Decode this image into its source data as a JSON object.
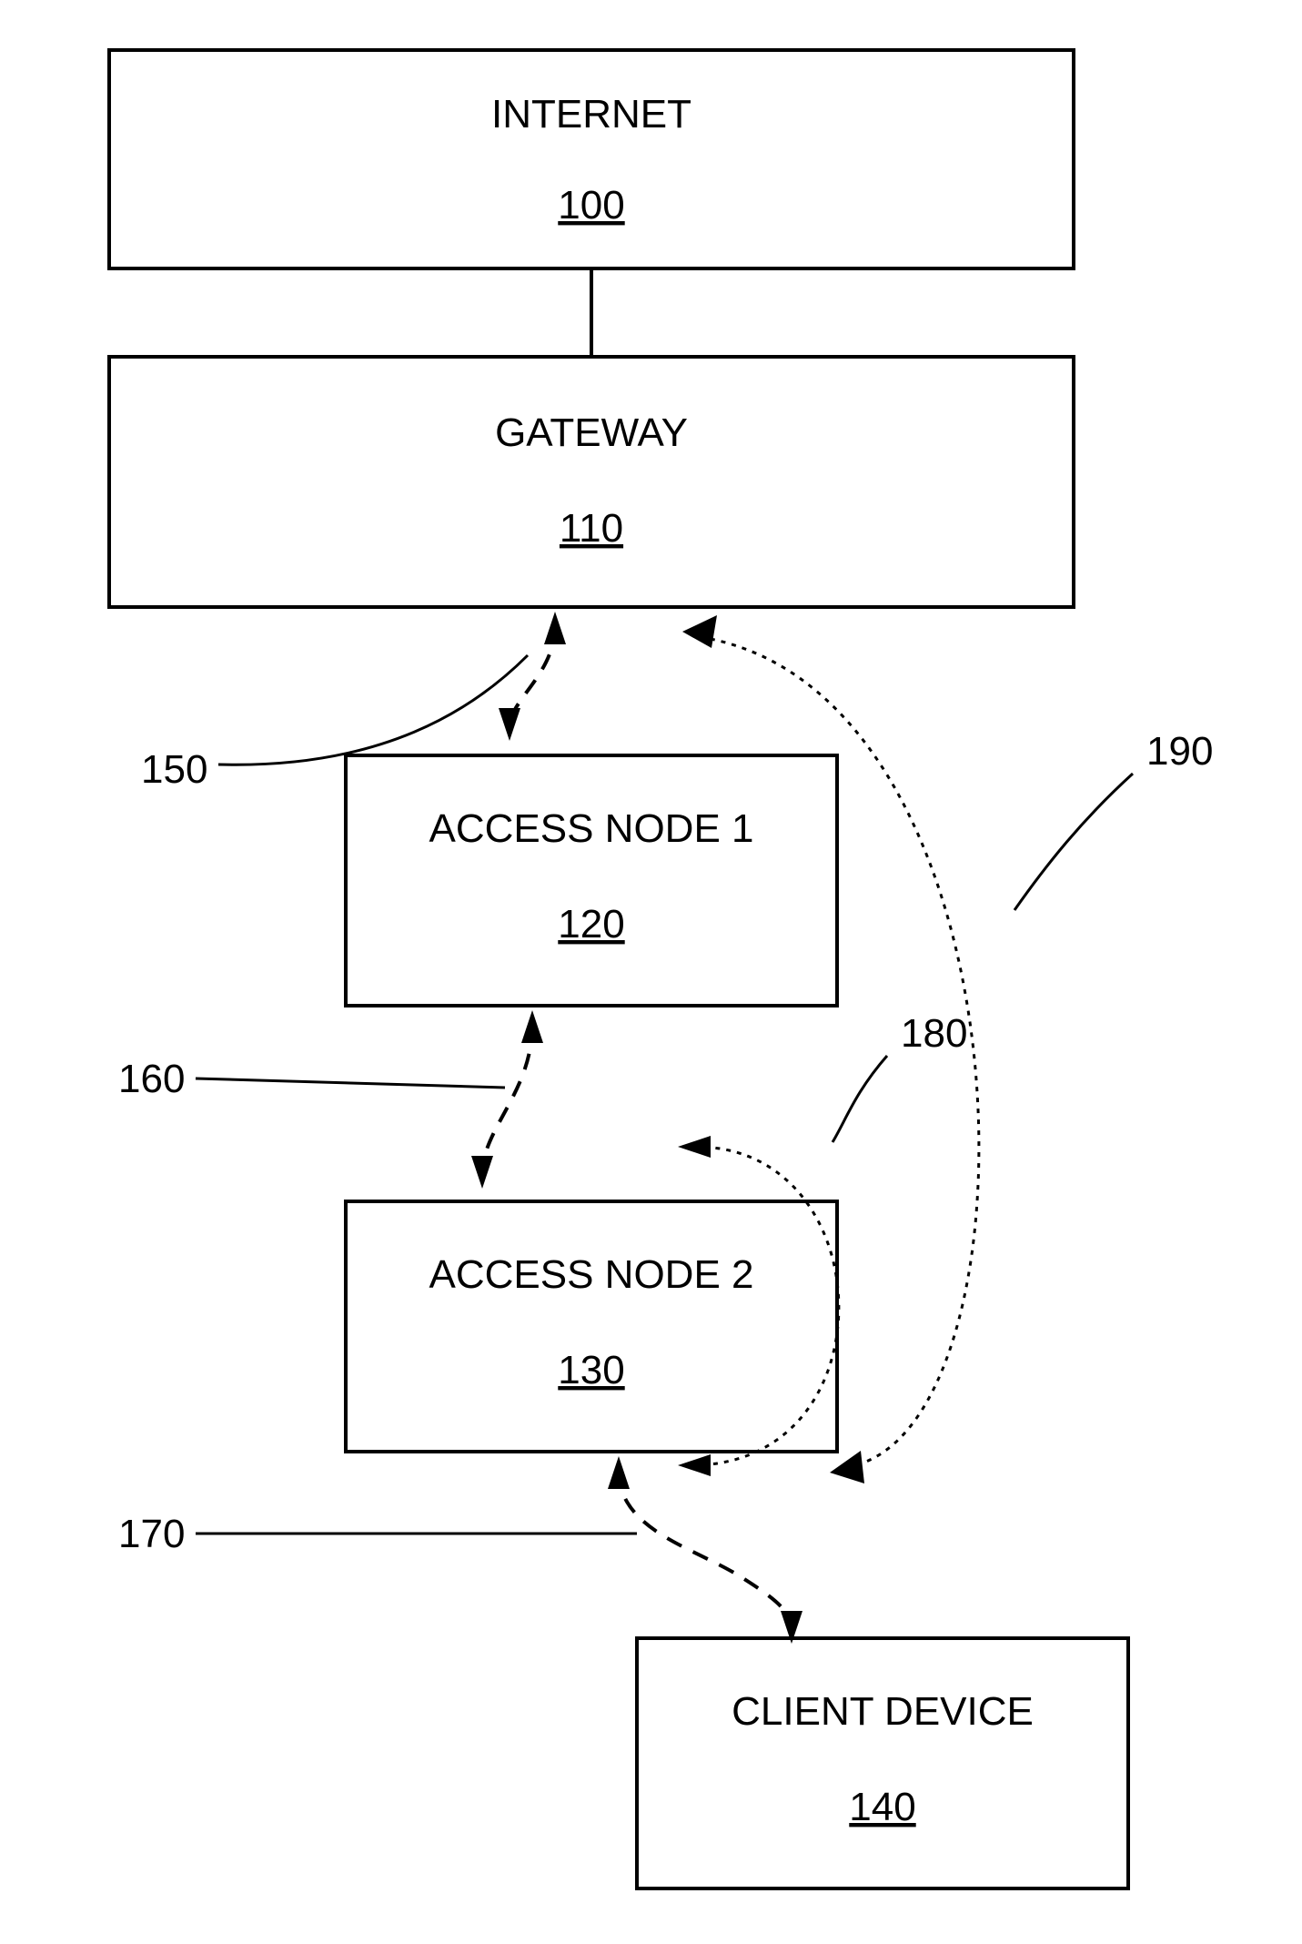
{
  "nodes": {
    "internet": {
      "title": "INTERNET",
      "ref": "100"
    },
    "gateway": {
      "title": "GATEWAY",
      "ref": "110"
    },
    "an1": {
      "title": "ACCESS NODE 1",
      "ref": "120"
    },
    "an2": {
      "title": "ACCESS NODE 2",
      "ref": "130"
    },
    "client": {
      "title": "CLIENT DEVICE",
      "ref": "140"
    }
  },
  "callouts": {
    "c150": "150",
    "c160": "160",
    "c170": "170",
    "c180": "180",
    "c190": "190"
  },
  "edges": {
    "e_internet_gateway": {
      "from": "internet",
      "to": "gateway",
      "style": "solid"
    },
    "e150": {
      "from": "gateway",
      "to": "an1",
      "style": "dashed",
      "bidir": true,
      "label_ref": "150"
    },
    "e160": {
      "from": "an1",
      "to": "an2",
      "style": "dashed",
      "bidir": true,
      "label_ref": "160"
    },
    "e170": {
      "from": "an2",
      "to": "client",
      "style": "dashed",
      "bidir": true,
      "label_ref": "170"
    },
    "e180": {
      "from": "client",
      "to": "an2",
      "style": "dotted",
      "bidir": true,
      "label_ref": "180"
    },
    "e190": {
      "from": "client",
      "to": "gateway",
      "style": "dotted",
      "bidir": true,
      "label_ref": "190"
    }
  }
}
